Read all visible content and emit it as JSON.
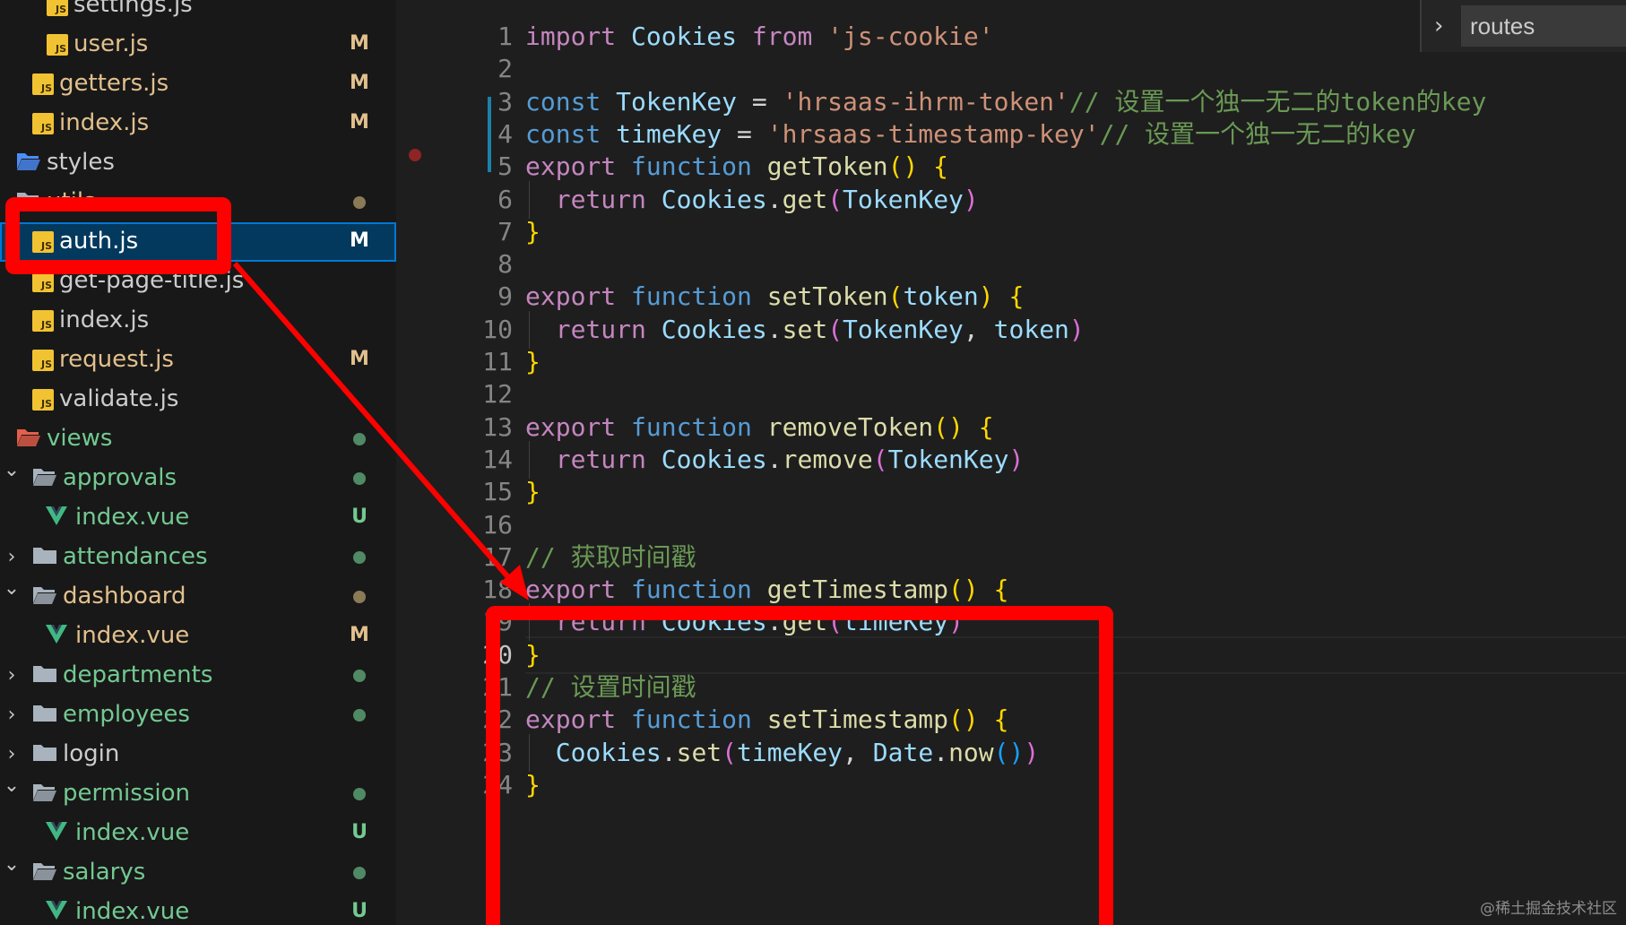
{
  "explorer": {
    "rows": [
      {
        "label": "settings.js",
        "type": "js",
        "status": "",
        "status_kind": ""
      },
      {
        "label": "user.js",
        "type": "js",
        "status": "M",
        "status_kind": "mod"
      },
      {
        "label": "getters.js",
        "type": "js",
        "status": "M",
        "status_kind": "mod"
      },
      {
        "label": "index.js",
        "type": "js",
        "status": "M",
        "status_kind": "mod"
      },
      {
        "label": "styles",
        "type": "folder-styles",
        "status": "",
        "status_kind": ""
      },
      {
        "label": "utils",
        "type": "folder-open",
        "status": "•",
        "status_kind": "dot-mod"
      },
      {
        "label": "auth.js",
        "type": "js",
        "status": "M",
        "status_kind": "mod",
        "selected": true
      },
      {
        "label": "get-page-title.js",
        "type": "js",
        "status": "",
        "status_kind": ""
      },
      {
        "label": "index.js",
        "type": "js",
        "status": "",
        "status_kind": ""
      },
      {
        "label": "request.js",
        "type": "js",
        "status": "M",
        "status_kind": "mod"
      },
      {
        "label": "validate.js",
        "type": "js",
        "status": "",
        "status_kind": ""
      },
      {
        "label": "views",
        "type": "folder-views",
        "status": "•",
        "status_kind": "dot-untracked"
      },
      {
        "label": "approvals",
        "type": "folder-open",
        "status": "•",
        "status_kind": "dot-untracked"
      },
      {
        "label": "index.vue",
        "type": "vue",
        "status": "U",
        "status_kind": "untracked"
      },
      {
        "label": "attendances",
        "type": "folder-closed",
        "status": "•",
        "status_kind": "dot-untracked"
      },
      {
        "label": "dashboard",
        "type": "folder-open",
        "status": "•",
        "status_kind": "dot-mod"
      },
      {
        "label": "index.vue",
        "type": "vue",
        "status": "M",
        "status_kind": "mod"
      },
      {
        "label": "departments",
        "type": "folder-closed",
        "status": "•",
        "status_kind": "dot-untracked"
      },
      {
        "label": "employees",
        "type": "folder-closed",
        "status": "•",
        "status_kind": "dot-untracked"
      },
      {
        "label": "login",
        "type": "folder-closed",
        "status": "",
        "status_kind": ""
      },
      {
        "label": "permission",
        "type": "folder-open",
        "status": "•",
        "status_kind": "dot-untracked"
      },
      {
        "label": "index.vue",
        "type": "vue",
        "status": "U",
        "status_kind": "untracked"
      },
      {
        "label": "salarys",
        "type": "folder-open",
        "status": "•",
        "status_kind": "dot-untracked"
      },
      {
        "label": "index.vue",
        "type": "vue",
        "status": "U",
        "status_kind": "untracked"
      }
    ]
  },
  "breadcrumb": {
    "label": "routes"
  },
  "editor": {
    "active_line": 20,
    "lines": [
      {
        "n": "1",
        "tokens": [
          [
            "kw",
            "import "
          ],
          [
            "var",
            "Cookies "
          ],
          [
            "kw",
            "from "
          ],
          [
            "str",
            "'js-cookie'"
          ]
        ]
      },
      {
        "n": "2",
        "tokens": []
      },
      {
        "n": "3",
        "tokens": [
          [
            "kw2",
            "const "
          ],
          [
            "var",
            "TokenKey "
          ],
          [
            "plain",
            "= "
          ],
          [
            "str",
            "'hrsaas-ihrm-token'"
          ],
          [
            "cmt",
            "// 设置一个独一无二的token的key"
          ]
        ]
      },
      {
        "n": "4",
        "tokens": [
          [
            "kw2",
            "const "
          ],
          [
            "var",
            "timeKey "
          ],
          [
            "plain",
            "= "
          ],
          [
            "str",
            "'hrsaas-timestamp-key'"
          ],
          [
            "cmt",
            "// 设置一个独一无二的key"
          ]
        ]
      },
      {
        "n": "5",
        "tokens": [
          [
            "kw",
            "export "
          ],
          [
            "kw2",
            "function "
          ],
          [
            "fn",
            "getToken"
          ],
          [
            "br1",
            "() {"
          ]
        ]
      },
      {
        "n": "6",
        "tokens": [
          [
            "plain",
            "  "
          ],
          [
            "kw",
            "return "
          ],
          [
            "var",
            "Cookies"
          ],
          [
            "plain",
            "."
          ],
          [
            "fn",
            "get"
          ],
          [
            "br2",
            "("
          ],
          [
            "var",
            "TokenKey"
          ],
          [
            "br2",
            ")"
          ]
        ]
      },
      {
        "n": "7",
        "tokens": [
          [
            "br1",
            "}"
          ]
        ]
      },
      {
        "n": "8",
        "tokens": []
      },
      {
        "n": "9",
        "tokens": [
          [
            "kw",
            "export "
          ],
          [
            "kw2",
            "function "
          ],
          [
            "fn",
            "setToken"
          ],
          [
            "br1",
            "("
          ],
          [
            "var",
            "token"
          ],
          [
            "br1",
            ") {"
          ]
        ]
      },
      {
        "n": "10",
        "tokens": [
          [
            "plain",
            "  "
          ],
          [
            "kw",
            "return "
          ],
          [
            "var",
            "Cookies"
          ],
          [
            "plain",
            "."
          ],
          [
            "fn",
            "set"
          ],
          [
            "br2",
            "("
          ],
          [
            "var",
            "TokenKey"
          ],
          [
            "plain",
            ", "
          ],
          [
            "var",
            "token"
          ],
          [
            "br2",
            ")"
          ]
        ]
      },
      {
        "n": "11",
        "tokens": [
          [
            "br1",
            "}"
          ]
        ]
      },
      {
        "n": "12",
        "tokens": []
      },
      {
        "n": "13",
        "tokens": [
          [
            "kw",
            "export "
          ],
          [
            "kw2",
            "function "
          ],
          [
            "fn",
            "removeToken"
          ],
          [
            "br1",
            "() {"
          ]
        ]
      },
      {
        "n": "14",
        "tokens": [
          [
            "plain",
            "  "
          ],
          [
            "kw",
            "return "
          ],
          [
            "var",
            "Cookies"
          ],
          [
            "plain",
            "."
          ],
          [
            "fn",
            "remove"
          ],
          [
            "br2",
            "("
          ],
          [
            "var",
            "TokenKey"
          ],
          [
            "br2",
            ")"
          ]
        ]
      },
      {
        "n": "15",
        "tokens": [
          [
            "br1",
            "}"
          ]
        ]
      },
      {
        "n": "16",
        "tokens": []
      },
      {
        "n": "17",
        "tokens": [
          [
            "cmt",
            "// 获取时间戳"
          ]
        ]
      },
      {
        "n": "18",
        "tokens": [
          [
            "kw",
            "export "
          ],
          [
            "kw2",
            "function "
          ],
          [
            "fn",
            "getTimestamp"
          ],
          [
            "br1",
            "() {"
          ]
        ]
      },
      {
        "n": "19",
        "tokens": [
          [
            "plain",
            "  "
          ],
          [
            "kw",
            "return "
          ],
          [
            "var",
            "Cookies"
          ],
          [
            "plain",
            "."
          ],
          [
            "fn",
            "get"
          ],
          [
            "br2",
            "("
          ],
          [
            "var",
            "timeKey"
          ],
          [
            "br2",
            ")"
          ]
        ]
      },
      {
        "n": "20",
        "tokens": [
          [
            "br1",
            "}"
          ]
        ]
      },
      {
        "n": "21",
        "tokens": [
          [
            "cmt",
            "// 设置时间戳"
          ]
        ]
      },
      {
        "n": "22",
        "tokens": [
          [
            "kw",
            "export "
          ],
          [
            "kw2",
            "function "
          ],
          [
            "fn",
            "setTimestamp"
          ],
          [
            "br1",
            "() {"
          ]
        ]
      },
      {
        "n": "23",
        "tokens": [
          [
            "plain",
            "  "
          ],
          [
            "var",
            "Cookies"
          ],
          [
            "plain",
            "."
          ],
          [
            "fn",
            "set"
          ],
          [
            "br2",
            "("
          ],
          [
            "var",
            "timeKey"
          ],
          [
            "plain",
            ", "
          ],
          [
            "var",
            "Date"
          ],
          [
            "plain",
            "."
          ],
          [
            "fn",
            "now"
          ],
          [
            "br3",
            "()"
          ],
          [
            "br2",
            ")"
          ]
        ]
      },
      {
        "n": "24",
        "tokens": [
          [
            "br1",
            "}"
          ]
        ]
      }
    ]
  },
  "watermark": "@稀土掘金技术社区",
  "colors": {
    "annotation": "#ff0000",
    "selection": "#04395e",
    "accent": "#0078d4"
  }
}
